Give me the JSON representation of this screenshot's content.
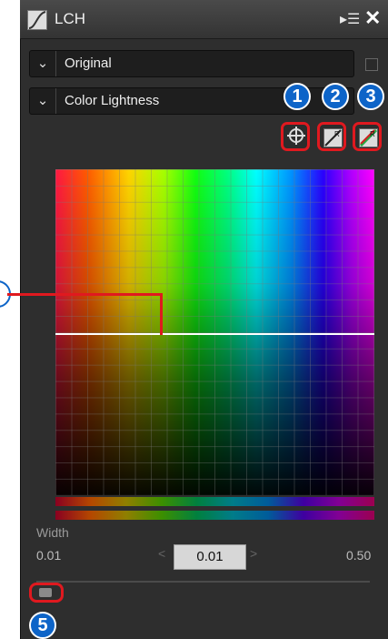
{
  "panel": {
    "title": "LCH",
    "title_icon": "curve-icon",
    "menu_icon_label": "▸☰",
    "close_icon_label": "✕"
  },
  "rows": {
    "original": {
      "label": "Original",
      "chevron": "⌄"
    },
    "mode": {
      "label": "Color Lightness",
      "chevron": "⌄"
    }
  },
  "tools": [
    {
      "number": "1",
      "icon": "eyedropper-crosshair-icon"
    },
    {
      "number": "2",
      "icon": "reset-channel-icon"
    },
    {
      "number": "3",
      "icon": "reset-all-icon"
    }
  ],
  "callouts": {
    "five": "5"
  },
  "width_control": {
    "label": "Width",
    "min": "0.01",
    "value": "0.01",
    "max": "0.50",
    "arrow_left": "<",
    "arrow_right": ">"
  },
  "colors": {
    "accent_red": "#e0191f",
    "badge_blue": "#0d64c8",
    "panel_bg": "#2e2e2e"
  }
}
